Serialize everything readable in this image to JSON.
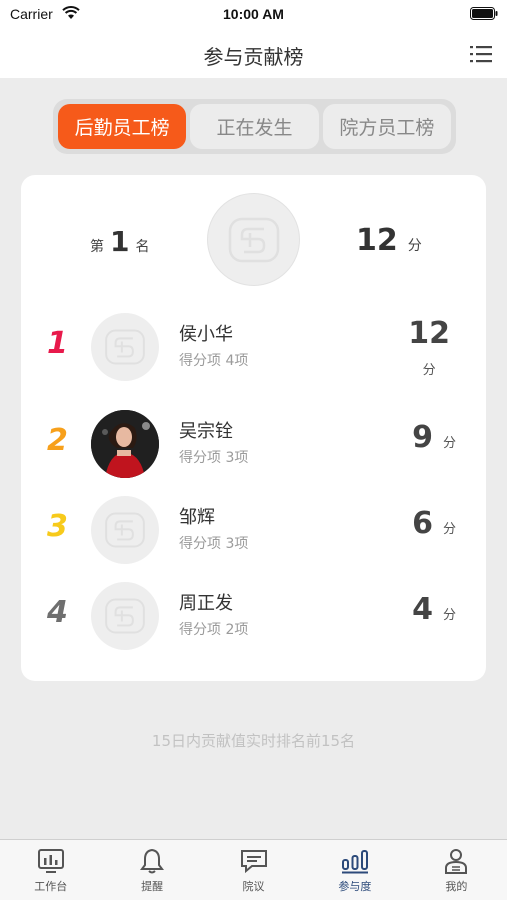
{
  "status_bar": {
    "carrier": "Carrier",
    "time": "10:00 AM"
  },
  "nav": {
    "title": "参与贡献榜",
    "menu_icon": "list-icon"
  },
  "tabs": [
    {
      "label": "后勤员工榜",
      "active": true
    },
    {
      "label": "正在发生",
      "active": false
    },
    {
      "label": "院方员工榜",
      "active": false
    }
  ],
  "me": {
    "rank_prefix": "第",
    "rank": "1",
    "rank_suffix": "名",
    "score": "12",
    "score_unit": "分"
  },
  "ranking": [
    {
      "rank": "1",
      "name": "侯小华",
      "items": "得分项 4项",
      "score": "12",
      "unit": "分",
      "rank_color": "#e8194b"
    },
    {
      "rank": "2",
      "name": "吴宗铨",
      "items": "得分项 3项",
      "score": "9",
      "unit": "分",
      "rank_color": "#f7a01b"
    },
    {
      "rank": "3",
      "name": "邹辉",
      "items": "得分项 3项",
      "score": "6",
      "unit": "分",
      "rank_color": "#f7ca1b"
    },
    {
      "rank": "4",
      "name": "周正发",
      "items": "得分项 2项",
      "score": "4",
      "unit": "分",
      "rank_color": "#6f6f6f"
    }
  ],
  "footer_note": "15日内贡献值实时排名前15名",
  "tab_bar": [
    {
      "label": "工作台",
      "icon": "chart-board-icon",
      "active": false
    },
    {
      "label": "提醒",
      "icon": "bell-icon",
      "active": false
    },
    {
      "label": "院议",
      "icon": "chat-icon",
      "active": false
    },
    {
      "label": "参与度",
      "icon": "bar-chart-icon",
      "active": true
    },
    {
      "label": "我的",
      "icon": "user-icon",
      "active": false
    }
  ]
}
